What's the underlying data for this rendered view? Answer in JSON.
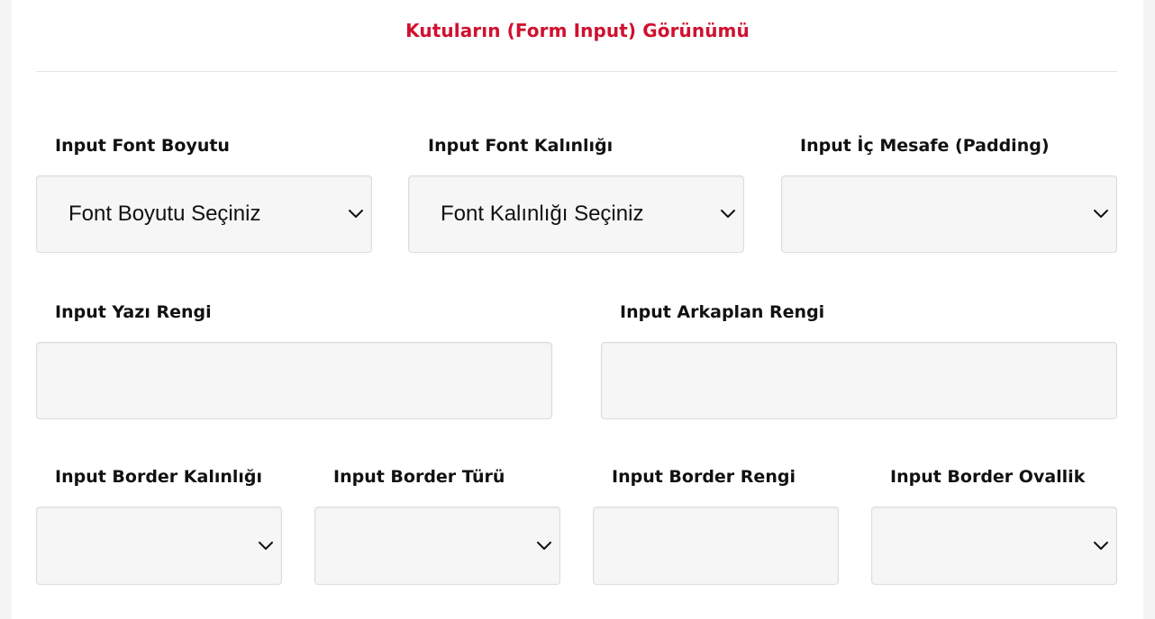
{
  "section": {
    "title": "Kutuların (Form Input) Görünümü",
    "accent_color": "#d0102f"
  },
  "row1": {
    "font_size": {
      "label": "Input Font Boyutu",
      "value": "Font Boyutu Seçiniz",
      "icon": "chevron-down-icon"
    },
    "font_weight": {
      "label": "Input Font Kalınlığı",
      "value": "Font Kalınlığı Seçiniz",
      "icon": "chevron-down-icon"
    },
    "padding": {
      "label": "Input İç Mesafe (Padding)",
      "value": "",
      "icon": "chevron-down-icon"
    }
  },
  "row2": {
    "text_color": {
      "label": "Input Yazı Rengi",
      "value": ""
    },
    "background_color": {
      "label": "Input Arkaplan Rengi",
      "value": ""
    }
  },
  "row3": {
    "border_width": {
      "label": "Input Border Kalınlığı",
      "value": "",
      "icon": "chevron-down-icon"
    },
    "border_style": {
      "label": "Input Border Türü",
      "value": "",
      "icon": "chevron-down-icon"
    },
    "border_color": {
      "label": "Input Border Rengi",
      "value": ""
    },
    "border_radius": {
      "label": "Input Border Ovallik",
      "value": "",
      "icon": "chevron-down-icon"
    }
  }
}
